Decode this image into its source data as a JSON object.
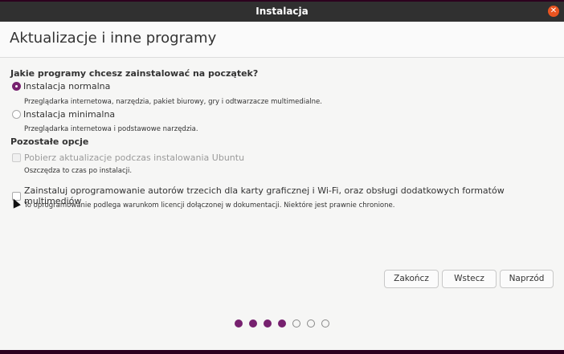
{
  "window": {
    "title": "Instalacja",
    "close_icon": "close-icon"
  },
  "page": {
    "title": "Aktualizacje i inne programy"
  },
  "question": "Jakie programy chcesz zainstalować na początek?",
  "options": [
    {
      "label": "Instalacja normalna",
      "description": "Przeglądarka internetowa, narzędzia, pakiet biurowy, gry i odtwarzacze multimedialne.",
      "selected": true
    },
    {
      "label": "Instalacja minimalna",
      "description": "Przeglądarka internetowa i podstawowe narzędzia.",
      "selected": false
    }
  ],
  "other_heading": "Pozostałe opcje",
  "checks": [
    {
      "label": "Pobierz aktualizacje podczas instalowania Ubuntu",
      "description": "Oszczędza to czas po instalacji.",
      "checked": false,
      "disabled": true
    },
    {
      "label": "Zainstaluj oprogramowanie autorów trzecich dla karty graficznej i Wi-Fi, oraz obsługi dodatkowych formatów multimediów",
      "description": "To oprogramowanie podlega warunkom licencji dołączonej w dokumentacji. Niektóre jest prawnie chronione.",
      "checked": false,
      "disabled": false
    }
  ],
  "buttons": {
    "quit": "Zakończ",
    "back": "Wstecz",
    "forward": "Naprzód"
  },
  "progress": {
    "current_step": 4,
    "total_steps": 7
  },
  "colors": {
    "accent": "#77216f",
    "close": "#e95420"
  }
}
